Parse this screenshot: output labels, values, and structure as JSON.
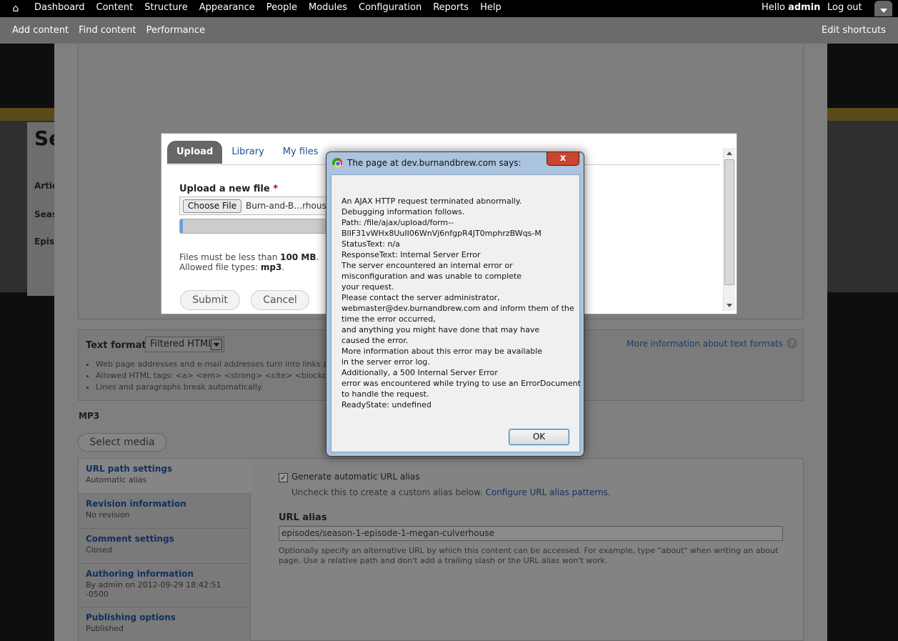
{
  "toolbar": {
    "menu": [
      "Dashboard",
      "Content",
      "Structure",
      "Appearance",
      "People",
      "Modules",
      "Configuration",
      "Reports",
      "Help"
    ],
    "hello": "Hello",
    "username": "admin",
    "logout": "Log out"
  },
  "shortcuts": {
    "links": [
      "Add content",
      "Find content",
      "Performance"
    ],
    "edit": "Edit shortcuts"
  },
  "background": {
    "left_peek": [
      "Se",
      "Artic",
      "Seas",
      "Epis"
    ],
    "text_format": {
      "label": "Text format",
      "selected": "Filtered HTML",
      "more_info": "More information about text formats",
      "tips": [
        "Web page addresses and e-mail addresses turn into links automatically.",
        "Allowed HTML tags: <a> <em> <strong> <cite> <blockquote>",
        "Lines and paragraphs break automatically."
      ]
    },
    "mp3_label": "MP3",
    "select_media": "Select media",
    "vertical_tabs": [
      {
        "title": "URL path settings",
        "summary": "Automatic alias"
      },
      {
        "title": "Revision information",
        "summary": "No revision"
      },
      {
        "title": "Comment settings",
        "summary": "Closed"
      },
      {
        "title": "Authoring information",
        "summary": "By admin on 2012-09-29 18:42:51 -0500"
      },
      {
        "title": "Publishing options",
        "summary": "Published"
      }
    ],
    "url_pane": {
      "checkbox_label": "Generate automatic URL alias",
      "checkbox_desc": "Uncheck this to create a custom alias below.",
      "checkbox_link": "Configure URL alias patterns.",
      "alias_label": "URL alias",
      "alias_value": "episodes/season-1-episode-1-megan-culverhouse",
      "alias_desc": "Optionally specify an alternative URL by which this content can be accessed. For example, type \"about\" when writing an about page. Use a relative path and don't add a trailing slash or the URL alias won't work."
    }
  },
  "media_browser": {
    "tabs": [
      "Upload",
      "Library",
      "My files"
    ],
    "upload_label": "Upload a new file",
    "required_mark": "*",
    "choose_file": "Choose File",
    "file_name": "Burn-and-B…rhouse",
    "progress_fraction": 0.02,
    "limits_line1_prefix": "Files must be less than",
    "limits_size": "100 MB",
    "limits_line2_prefix": "Allowed file types:",
    "limits_types": "mp3",
    "submit": "Submit",
    "cancel": "Cancel"
  },
  "alert": {
    "title": "The page at dev.burnandbrew.com says:",
    "close": "x",
    "lines": [
      "An AJAX HTTP request terminated abnormally.",
      "Debugging information follows.",
      "Path: /file/ajax/upload/form--",
      "BlIF31vWHx8UuII06WnVj6nfgpR4JT0mphrzBWqs-M",
      "StatusText: n/a",
      "ResponseText: Internal Server Error",
      "The server encountered an internal error or",
      "misconfiguration and was unable to complete",
      "your request.",
      "Please contact the server administrator,",
      "webmaster@dev.burnandbrew.com and inform them of the",
      "time the error occurred,",
      "and anything you might have done that may have",
      "caused the error.",
      "More information about this error may be available",
      "in the server error log.",
      "Additionally, a 500 Internal Server Error",
      "error was encountered while trying to use an ErrorDocument",
      "to handle the request.",
      "ReadyState: undefined"
    ],
    "ok": "OK"
  }
}
